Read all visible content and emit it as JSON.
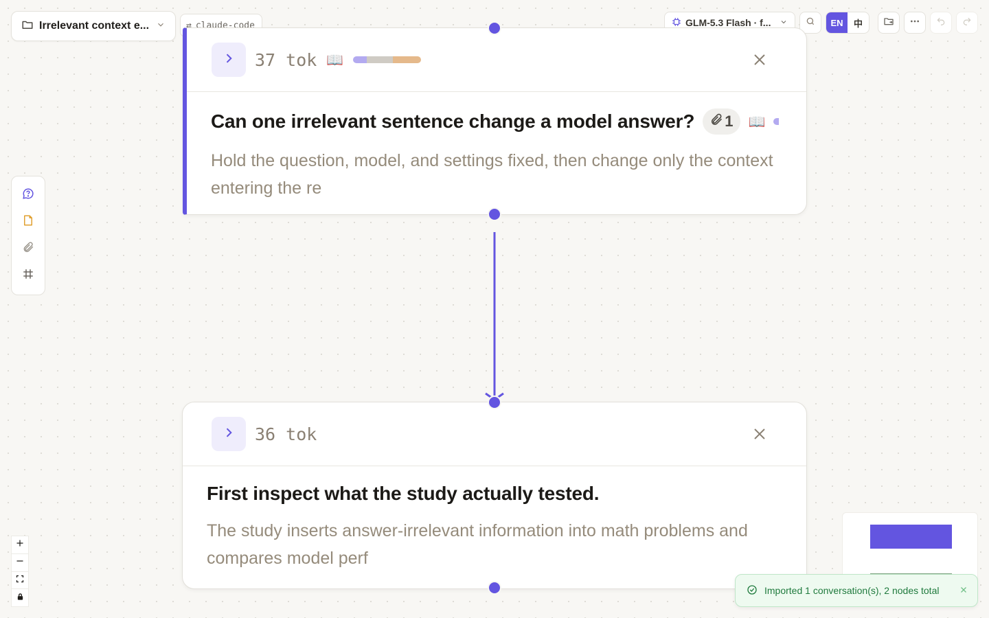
{
  "header": {
    "project_title": "Irrelevant context e...",
    "source_tag": "claude-code",
    "model_label": "GLM-5.3 Flash · f...",
    "lang_active": "EN",
    "lang_other": "中"
  },
  "icons": {
    "folder": "folder-icon",
    "swap": "swap-icon",
    "chip": "chip-icon",
    "search": "search-icon",
    "more": "more-icon",
    "undo": "undo-icon",
    "redo": "redo-icon"
  },
  "colors": {
    "accent": "#6355e0",
    "accent_soft": "#efedfc",
    "toast_bg": "#eefaf0",
    "toast_text": "#1f7a3d"
  },
  "nodes": [
    {
      "tokens": "37 tok",
      "title": "Can one irrelevant sentence change a model answer?",
      "attachment_count": "1",
      "snippet": "Hold the question, model, and settings fixed, then change only the context entering the re",
      "context_bar_fractions": [
        0.2,
        0.38,
        0.42
      ]
    },
    {
      "tokens": "36 tok",
      "title": "First inspect what the study actually tested.",
      "snippet": "The study inserts answer-irrelevant information into math problems and compares model perf"
    }
  ],
  "toast": {
    "message": "Imported 1 conversation(s), 2 nodes total"
  }
}
